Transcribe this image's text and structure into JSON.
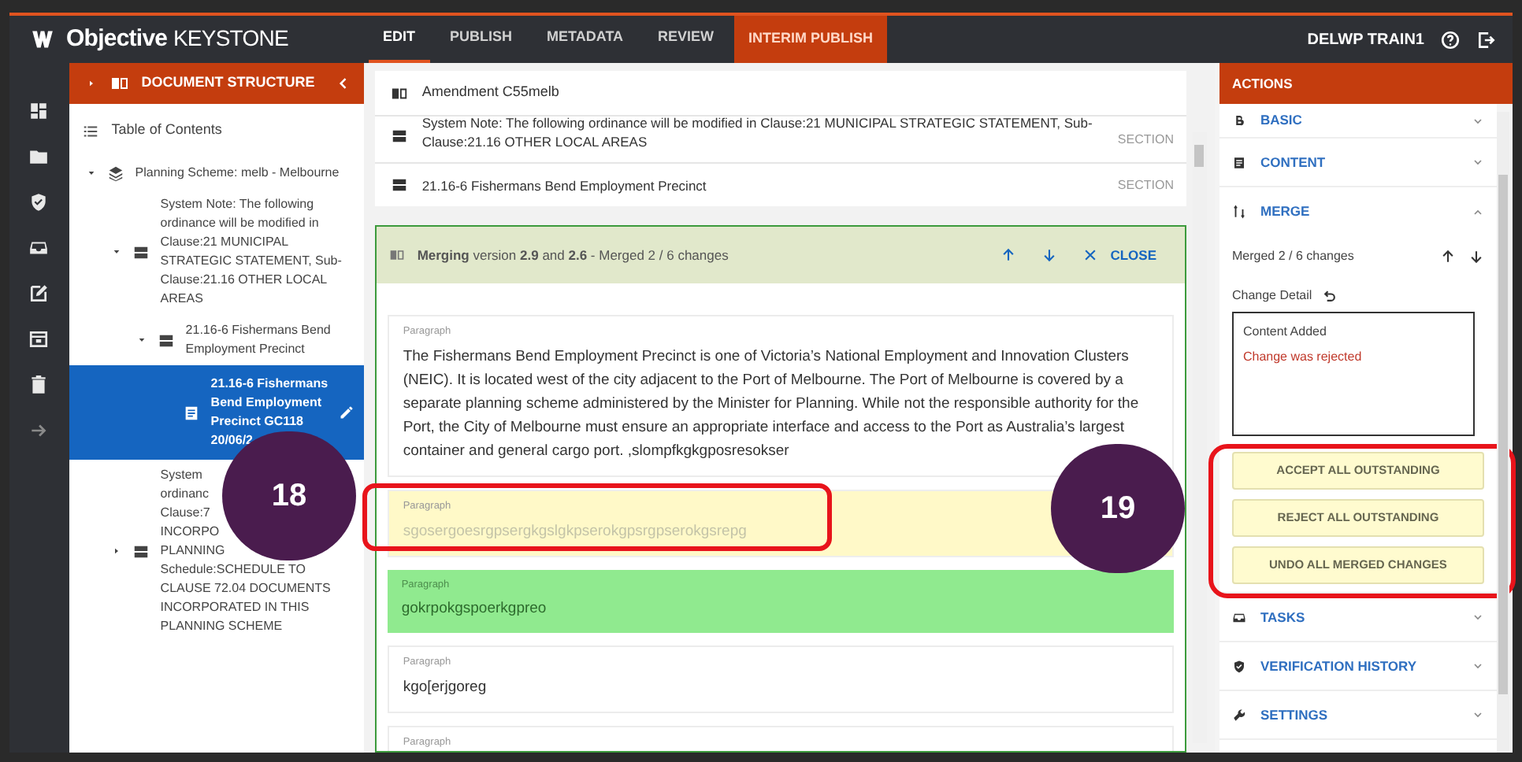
{
  "app": {
    "logo_bold": "Objective",
    "logo_light": "KEYSTONE",
    "user": "DELWP TRAIN1",
    "nav": [
      {
        "label": "EDIT",
        "selected": true,
        "kind": "tab"
      },
      {
        "label": "PUBLISH",
        "selected": false,
        "kind": "tab"
      },
      {
        "label": "METADATA",
        "selected": false,
        "kind": "tab"
      },
      {
        "label": "REVIEW",
        "selected": false,
        "kind": "tab"
      },
      {
        "label": "INTERIM PUBLISH",
        "selected": false,
        "kind": "highlight"
      }
    ]
  },
  "structure_panel": {
    "title": "DOCUMENT STRUCTURE",
    "toc": "Table of Contents",
    "tree": [
      {
        "label": "Planning Scheme: melb - Melbourne",
        "kind": "scheme",
        "expanded": true,
        "selected": false,
        "children": [
          {
            "label": "System Note: The following ordinance will be modified in Clause:21 MUNICIPAL STRATEGIC STATEMENT, Sub-Clause:21.16 OTHER LOCAL AREAS",
            "kind": "section",
            "expanded": true,
            "selected": false,
            "children": [
              {
                "label": "21.16-6 Fishermans Bend Employment Precinct",
                "kind": "section",
                "expanded": true,
                "selected": false,
                "children": [
                  {
                    "label": "21.16-6 Fishermans Bend Employment Precinct GC118 20/06/2",
                    "kind": "document",
                    "selected": true
                  }
                ]
              }
            ]
          },
          {
            "label": "System\nordinanc\nClause:7\nINCORPO\nPLANNING\nSchedule:SCHEDULE TO CLAUSE 72.04 DOCUMENTS INCORPORATED IN THIS PLANNING SCHEME",
            "kind": "section",
            "expanded": false,
            "selected": false
          }
        ]
      }
    ]
  },
  "document": {
    "title": "Amendment C55melb",
    "sections": [
      {
        "label": "System Note: The following ordinance will be modified in Clause:21 MUNICIPAL STRATEGIC STATEMENT, Sub-Clause:21.16 OTHER LOCAL AREAS",
        "type": "SECTION"
      },
      {
        "label": "21.16-6 Fishermans Bend Employment Precinct",
        "type": "SECTION"
      }
    ],
    "merge_bar": {
      "text": "**Merging** version **2.9** and **2.6** - Merged 2 / 6 changes",
      "close": "CLOSE"
    },
    "paragraphs": [
      {
        "label": "Paragraph",
        "kind": "none",
        "text": "The Fishermans Bend Employment Precinct is one of Victoria’s National Employment and Innovation Clusters (NEIC). It is located west of the city adjacent to the Port of Melbourne. The Port of Melbourne is covered by a separate planning scheme administered by the Minister for Planning. While not the responsible authority for the Port, the City of Melbourne must ensure an appropriate interface and access to the Port as Australia’s largest container and general cargo port. ,slompfkgkgposresokser"
      },
      {
        "label": "Paragraph",
        "kind": "rejected",
        "text": "sgosergoesrgpsergkgslgkpserokgpsrgpserokgsrepg"
      },
      {
        "label": "Paragraph",
        "kind": "added",
        "text": "gokrpokgspoerkgpreo"
      },
      {
        "label": "Paragraph",
        "kind": "none",
        "text": "kgo[erjgoreg"
      },
      {
        "label": "Paragraph",
        "kind": "none"
      }
    ]
  },
  "actions_panel": {
    "title": "ACTIONS",
    "sections": [
      {
        "label": "BASIC",
        "kind": "basic",
        "expanded": false
      },
      {
        "label": "CONTENT",
        "kind": "content",
        "expanded": false
      },
      {
        "label": "MERGE",
        "kind": "merge",
        "expanded": true
      },
      {
        "label": "TASKS",
        "kind": "tasks",
        "expanded": false
      },
      {
        "label": "VERIFICATION HISTORY",
        "kind": "verification",
        "expanded": false
      },
      {
        "label": "SETTINGS",
        "kind": "settings",
        "expanded": false
      }
    ],
    "merge": {
      "summary": "Merged 2 / 6 changes",
      "detail_label": "Change Detail",
      "detail_title": "Content Added",
      "detail_status": "Change was rejected",
      "buttons": [
        "ACCEPT ALL OUTSTANDING",
        "REJECT ALL OUTSTANDING",
        "UNDO ALL MERGED CHANGES"
      ]
    }
  },
  "annotations": [
    {
      "number": "18"
    },
    {
      "number": "19"
    }
  ]
}
